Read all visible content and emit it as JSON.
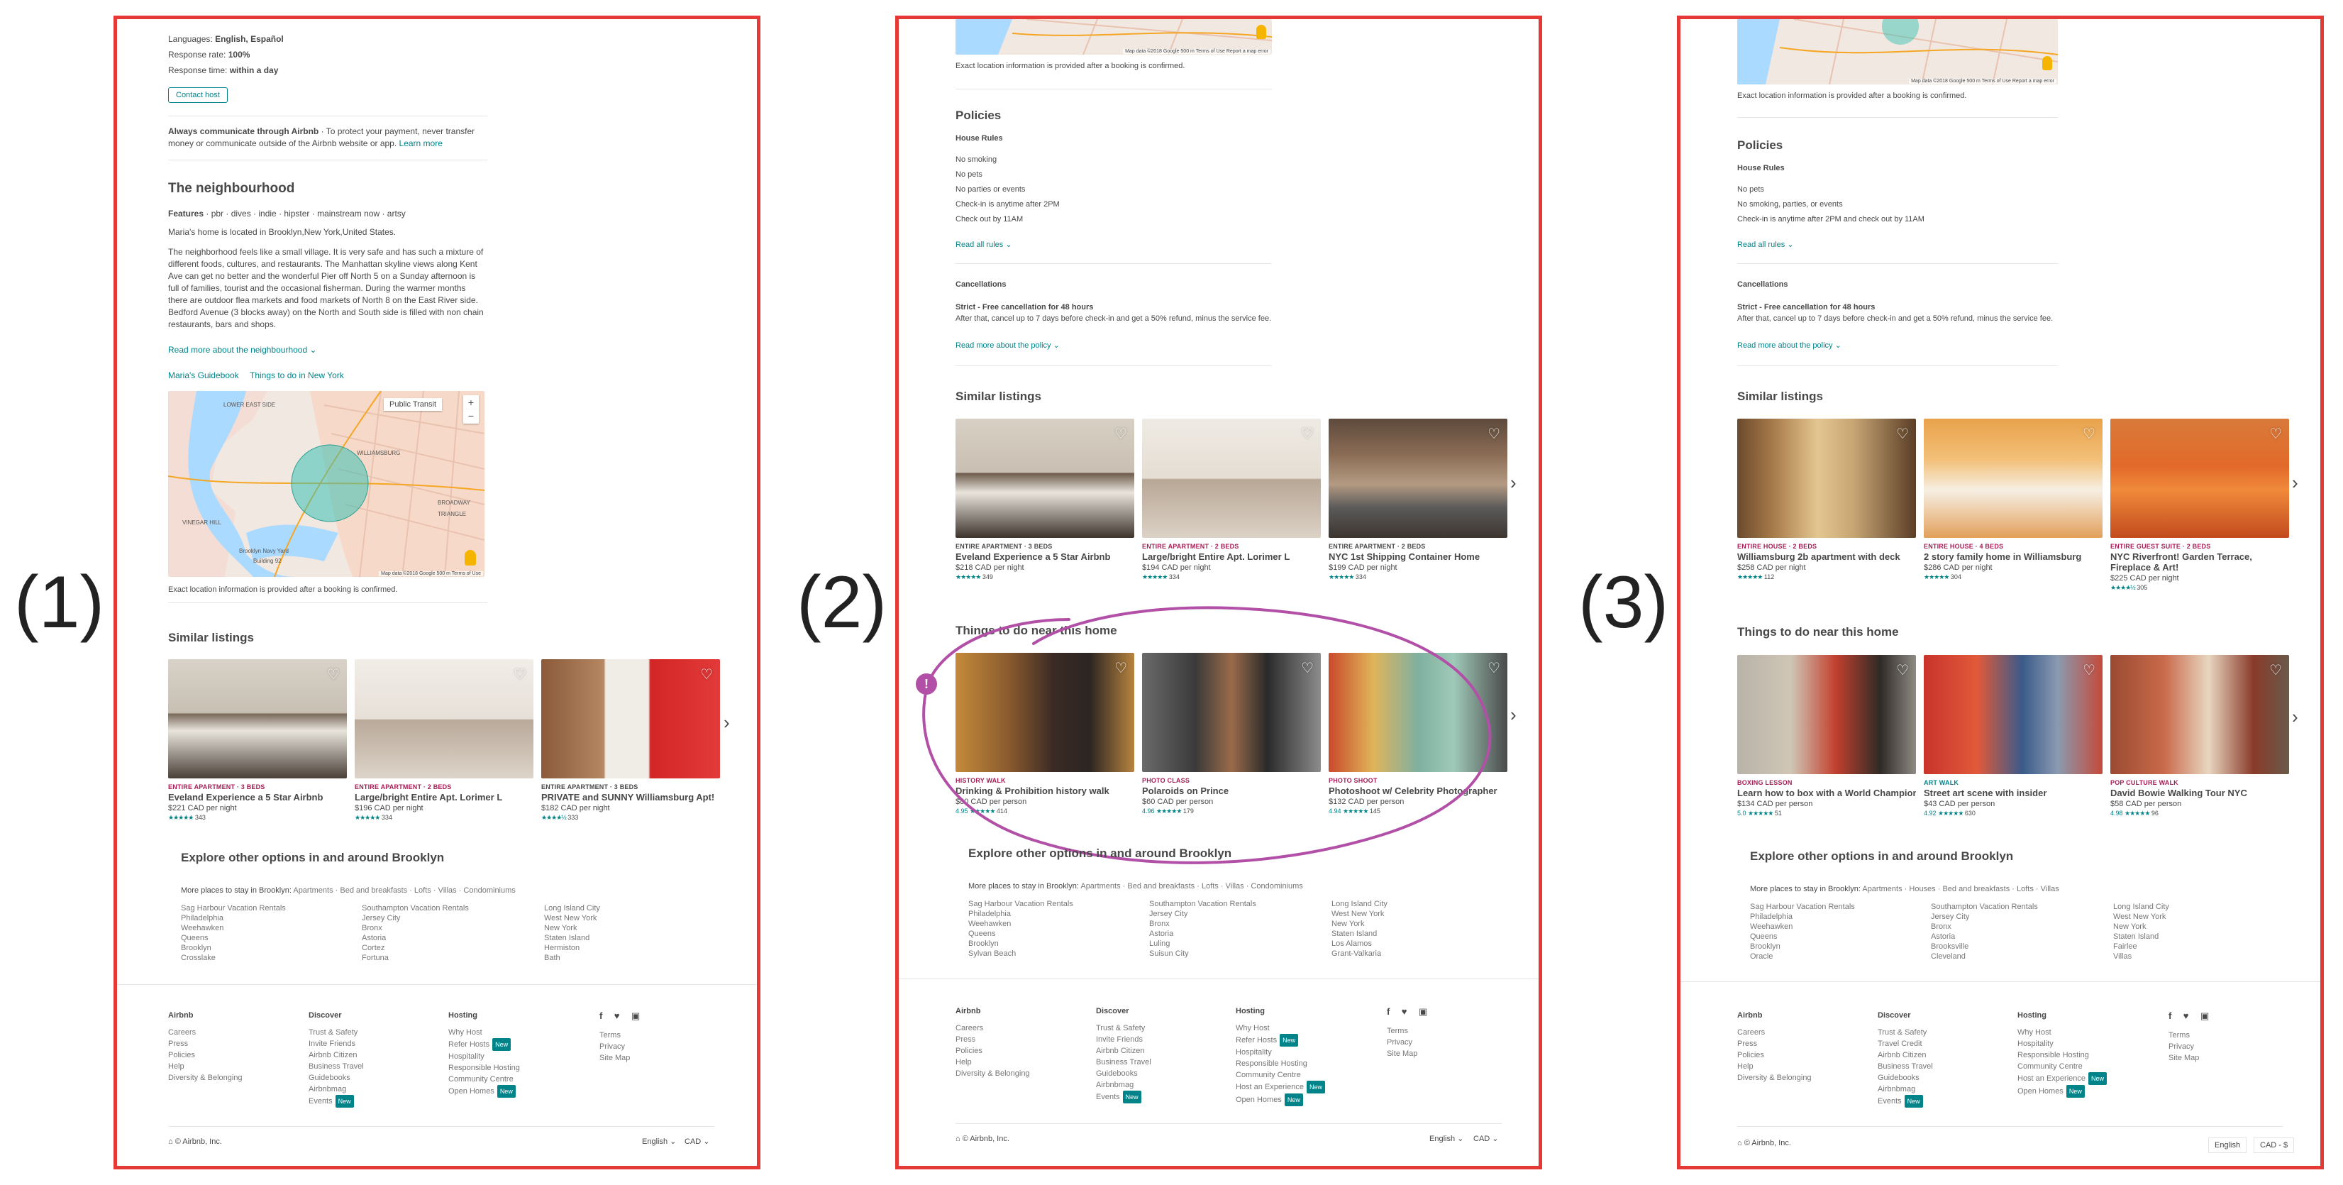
{
  "labels": [
    "(1)",
    "(2)",
    "(3)"
  ],
  "p1": {
    "languages_label": "Languages:",
    "languages_value": "English, Español",
    "response_rate_label": "Response rate:",
    "response_rate_value": "100%",
    "response_time_label": "Response time:",
    "response_time_value": "within a day",
    "contact_host": "Contact host",
    "always_bold": "Always communicate through Airbnb",
    "always_rest": " · To protect your payment, never transfer money or communicate outside of the Airbnb website or app.",
    "learn_more": "Learn more",
    "neighbourhood_title": "The neighbourhood",
    "features_label": "Features",
    "features_value": " · pbr · dives · indie · hipster · mainstream now · artsy",
    "located": "Maria's home is located in Brooklyn,New York,United States.",
    "description": "The neighborhood feels like a small village. It is very safe and has such a mixture of different foods, cultures, and restaurants. The Manhattan skyline views along Kent Ave can get no better and the wonderful Pier off North 5 on a Sunday afternoon is full of families, tourist and the occasional fisherman. During the warmer months there are outdoor flea markets and food markets of North 8 on the East River side. Bedford Avenue (3 blocks away) on the North and South side is filled with non chain restaurants, bars and shops.",
    "read_more": "Read more about the neighbourhood",
    "guidebook": "Maria's Guidebook",
    "things_ny": "Things to do in New York",
    "map_btn": "Public Transit",
    "map_areas": [
      "LOWER EAST SIDE",
      "WILLIAMSBURG",
      "VINEGAR HILL",
      "BROADWAY TRIANGLE",
      "Brooklyn Navy Yard",
      "Building 92"
    ],
    "map_footer": "Map data ©2018 Google   500 m   Terms of Use",
    "exact": "Exact location information is provided after a booking is confirmed.",
    "similar_title": "Similar listings",
    "cards": [
      {
        "cat": "ENTIRE APARTMENT · 3 BEDS",
        "title": "Eveland Experience a 5 Star Airbnb",
        "price": "$221 CAD per night",
        "stars": "★★★★★",
        "count": "343"
      },
      {
        "cat": "ENTIRE APARTMENT · 2 BEDS",
        "title": "Large/bright Entire Apt. Lorimer L",
        "price": "$196 CAD per night",
        "stars": "★★★★★",
        "count": "334"
      },
      {
        "cat": "ENTIRE APARTMENT · 3 BEDS",
        "title": "PRIVATE and SUNNY Williamsburg Apt!",
        "price": "$182 CAD per night",
        "stars": "★★★★½",
        "count": "333"
      }
    ],
    "explore_title": "Explore other options in and around Brooklyn",
    "more_places_label": "More places to stay in Brooklyn:",
    "more_places_value": " Apartments · Bed and breakfasts · Lofts · Villas · Condominiums",
    "col1": [
      "Sag Harbour Vacation Rentals",
      "Philadelphia",
      "Weehawken",
      "Queens",
      "Brooklyn",
      "Crosslake"
    ],
    "col2": [
      "Southampton Vacation Rentals",
      "Jersey City",
      "Bronx",
      "Astoria",
      "Cortez",
      "Fortuna"
    ],
    "col3": [
      "Long Island City",
      "West New York",
      "New York",
      "Staten Island",
      "Hermiston",
      "Bath"
    ],
    "footer": {
      "airbnb_h": "Airbnb",
      "airbnb": [
        "Careers",
        "Press",
        "Policies",
        "Help",
        "Diversity & Belonging"
      ],
      "discover_h": "Discover",
      "discover": [
        "Trust & Safety",
        "Invite Friends",
        "Airbnb Citizen",
        "Business Travel",
        "Guidebooks",
        "Airbnbmag",
        "Events"
      ],
      "hosting_h": "Hosting",
      "hosting": [
        "Why Host",
        "Refer Hosts",
        "Hospitality",
        "Responsible Hosting",
        "Community Centre",
        "Open Homes"
      ],
      "legal": [
        "Terms",
        "Privacy",
        "Site Map"
      ],
      "copyright": "© Airbnb, Inc.",
      "lang": "English",
      "currency": "CAD",
      "new": "New"
    }
  },
  "p2": {
    "map_footer": "Map data ©2018 Google   500 m   Terms of Use   Report a map error",
    "exact": "Exact location information is provided after a booking is confirmed.",
    "policies_title": "Policies",
    "house_rules": "House Rules",
    "rules": [
      "No smoking",
      "No pets",
      "No parties or events",
      "Check-in is anytime after 2PM",
      "Check out by 11AM"
    ],
    "read_all": "Read all rules",
    "cancellations": "Cancellations",
    "strict": "Strict - Free cancellation for 48 hours",
    "strict_desc": "After that, cancel up to 7 days before check-in and get a 50% refund, minus the service fee.",
    "read_policy": "Read more about the policy",
    "similar_title": "Similar listings",
    "cards": [
      {
        "cat": "ENTIRE APARTMENT · 3 BEDS",
        "title": "Eveland Experience a 5 Star Airbnb",
        "price": "$218 CAD per night",
        "stars": "★★★★★",
        "count": "349"
      },
      {
        "cat": "ENTIRE APARTMENT · 2 BEDS",
        "title": "Large/bright Entire Apt. Lorimer L",
        "price": "$194 CAD per night",
        "stars": "★★★★★",
        "count": "334"
      },
      {
        "cat": "ENTIRE APARTMENT · 2 BEDS",
        "title": "NYC 1st Shipping Container Home",
        "price": "$199 CAD per night",
        "stars": "★★★★★",
        "count": "334"
      }
    ],
    "things_title": "Things to do near this home",
    "experiences": [
      {
        "cat": "HISTORY WALK",
        "title": "Drinking & Prohibition history walk",
        "price": "$80 CAD per person",
        "score": "4.95",
        "stars": "★★★★★",
        "count": "414"
      },
      {
        "cat": "PHOTO CLASS",
        "title": "Polaroids on Prince",
        "price": "$60 CAD per person",
        "score": "4.96",
        "stars": "★★★★★",
        "count": "179"
      },
      {
        "cat": "PHOTO SHOOT",
        "title": "Photoshoot w/ Celebrity Photographer",
        "price": "$132 CAD per person",
        "score": "4.94",
        "stars": "★★★★★",
        "count": "145"
      }
    ],
    "marker": "!",
    "explore_title": "Explore other options in and around Brooklyn",
    "more_places_label": "More places to stay in Brooklyn:",
    "more_places_value": " Apartments · Bed and breakfasts · Lofts · Villas · Condominiums",
    "col1": [
      "Sag Harbour Vacation Rentals",
      "Philadelphia",
      "Weehawken",
      "Queens",
      "Brooklyn",
      "Sylvan Beach"
    ],
    "col2": [
      "Southampton Vacation Rentals",
      "Jersey City",
      "Bronx",
      "Astoria",
      "Luling",
      "Suisun City"
    ],
    "col3": [
      "Long Island City",
      "West New York",
      "New York",
      "Staten Island",
      "Los Alamos",
      "Grant-Valkaria"
    ],
    "footer": {
      "airbnb_h": "Airbnb",
      "airbnb": [
        "Careers",
        "Press",
        "Policies",
        "Help",
        "Diversity & Belonging"
      ],
      "discover_h": "Discover",
      "discover": [
        "Trust & Safety",
        "Invite Friends",
        "Airbnb Citizen",
        "Business Travel",
        "Guidebooks",
        "Airbnbmag",
        "Events"
      ],
      "hosting_h": "Hosting",
      "hosting": [
        "Why Host",
        "Refer Hosts",
        "Hospitality",
        "Responsible Hosting",
        "Community Centre",
        "Host an Experience",
        "Open Homes"
      ],
      "legal": [
        "Terms",
        "Privacy",
        "Site Map"
      ],
      "copyright": "© Airbnb, Inc.",
      "lang": "English",
      "currency": "CAD",
      "new": "New"
    }
  },
  "p3": {
    "map_footer": "Map data ©2018 Google   500 m   Terms of Use   Report a map error",
    "exact": "Exact location information is provided after a booking is confirmed.",
    "policies_title": "Policies",
    "house_rules": "House Rules",
    "rules": [
      "No pets",
      "No smoking, parties, or events",
      "Check-in is anytime after 2PM and check out by 11AM"
    ],
    "read_all": "Read all rules",
    "cancellations": "Cancellations",
    "strict": "Strict - Free cancellation for 48 hours",
    "strict_desc": "After that, cancel up to 7 days before check-in and get a 50% refund, minus the service fee.",
    "read_policy": "Read more about the policy",
    "similar_title": "Similar listings",
    "cards": [
      {
        "cat": "ENTIRE HOUSE · 2 BEDS",
        "title": "Williamsburg 2b apartment with deck",
        "price": "$258 CAD per night",
        "stars": "★★★★★",
        "count": "112"
      },
      {
        "cat": "ENTIRE HOUSE · 4 BEDS",
        "title": "2 story family home in Williamsburg",
        "price": "$286 CAD per night",
        "stars": "★★★★★",
        "count": "304"
      },
      {
        "cat": "ENTIRE GUEST SUITE · 2 BEDS",
        "title": "NYC Riverfront! Garden Terrace, Fireplace & Art!",
        "price": "$225 CAD per night",
        "stars": "★★★★½",
        "count": "305"
      }
    ],
    "things_title": "Things to do near this home",
    "experiences": [
      {
        "cat": "BOXING LESSON",
        "title": "Learn how to box with a World Champion",
        "price": "$134 CAD per person",
        "score": "5.0",
        "stars": "★★★★★",
        "count": "51"
      },
      {
        "cat": "ART WALK",
        "title": "Street art scene with insider",
        "price": "$43 CAD per person",
        "score": "4.92",
        "stars": "★★★★★",
        "count": "630"
      },
      {
        "cat": "POP CULTURE WALK",
        "title": "David Bowie Walking Tour NYC",
        "price": "$58 CAD per person",
        "score": "4.98",
        "stars": "★★★★★",
        "count": "96"
      }
    ],
    "explore_title": "Explore other options in and around Brooklyn",
    "more_places_label": "More places to stay in Brooklyn:",
    "more_places_value": " Apartments · Houses · Bed and breakfasts · Lofts · Villas",
    "col1": [
      "Sag Harbour Vacation Rentals",
      "Philadelphia",
      "Weehawken",
      "Queens",
      "Brooklyn",
      "Oracle"
    ],
    "col2": [
      "Southampton Vacation Rentals",
      "Jersey City",
      "Bronx",
      "Astoria",
      "Brooksville",
      "Cleveland"
    ],
    "col3": [
      "Long Island City",
      "West New York",
      "New York",
      "Staten Island",
      "Fairlee",
      "Villas"
    ],
    "footer": {
      "airbnb_h": "Airbnb",
      "airbnb": [
        "Careers",
        "Press",
        "Policies",
        "Help",
        "Diversity & Belonging"
      ],
      "discover_h": "Discover",
      "discover": [
        "Trust & Safety",
        "Travel Credit",
        "Airbnb Citizen",
        "Business Travel",
        "Guidebooks",
        "Airbnbmag",
        "Events"
      ],
      "hosting_h": "Hosting",
      "hosting": [
        "Why Host",
        "Hospitality",
        "Responsible Hosting",
        "Community Centre",
        "Host an Experience",
        "Open Homes"
      ],
      "legal": [
        "Terms",
        "Privacy",
        "Site Map"
      ],
      "copyright": "© Airbnb, Inc.",
      "lang": "English",
      "currency": "CAD - $",
      "new": "New"
    }
  },
  "colors": {
    "teal": "#008489",
    "frame": "#e53935",
    "annotation": "#b24fa6",
    "listing_cat": "#a61d55",
    "experience_cat": "#a61d55"
  }
}
